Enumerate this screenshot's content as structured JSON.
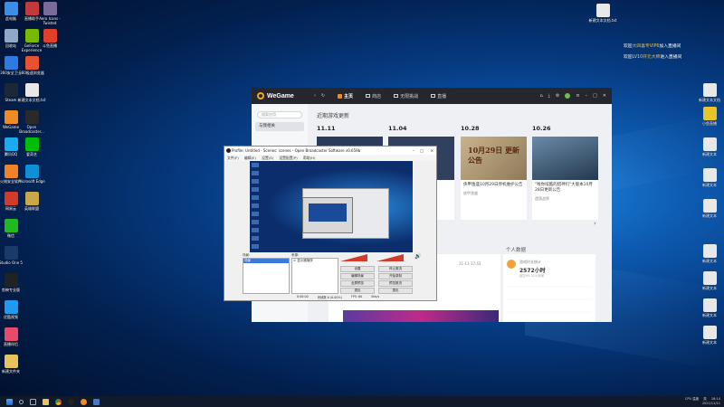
{
  "desktop_icons_left": [
    {
      "label": "此电脑",
      "color": "#3a8ee6"
    },
    {
      "label": "直播助手",
      "color": "#c23a3a"
    },
    {
      "label": "Aero Icons - Twisted",
      "color": "#7b6a9c"
    },
    {
      "label": "回收站",
      "color": "#8fa9c7"
    },
    {
      "label": "GeForce Experience",
      "color": "#76b900"
    },
    {
      "label": "斗鱼直播",
      "color": "#e0402a"
    },
    {
      "label": "360安全卫士",
      "color": "#2d7be0"
    },
    {
      "label": "360极速浏览器",
      "color": "#e8522f"
    },
    {
      "label": "Steam",
      "color": "#1b2838"
    },
    {
      "label": "新建文本文档.txt",
      "color": "#e8e8e8"
    },
    {
      "label": "WeGame",
      "color": "#f08a24"
    },
    {
      "label": "Open Broadcaster...",
      "color": "#2a2a2a"
    },
    {
      "label": "爱奇艺",
      "color": "#00be06"
    },
    {
      "label": "腾讯QQ",
      "color": "#1aabee"
    },
    {
      "label": "火绒安全软件",
      "color": "#f0832a"
    },
    {
      "label": "Microsoft Edge",
      "color": "#0f8fd6"
    },
    {
      "label": "英雄联盟",
      "color": "#c9a84a"
    },
    {
      "label": "网易云",
      "color": "#d23a2a"
    },
    {
      "label": "微信",
      "color": "#1fb922"
    },
    {
      "label": "Studio One 5",
      "color": "#1a3a6a"
    },
    {
      "label": "剪映专业版",
      "color": "#222"
    },
    {
      "label": "优酷视频",
      "color": "#1e9bf0"
    },
    {
      "label": "直播伴侣",
      "color": "#e84a6a"
    },
    {
      "label": "新建文件夹",
      "color": "#e8c35a"
    }
  ],
  "desktop_icons_right": [
    {
      "label": "新建文本文档.txt",
      "color": "#e8e8e8"
    },
    {
      "label": "新建文本文档",
      "color": "#e8e8e8"
    },
    {
      "label": "小鱼直播",
      "color": "#e8c32a"
    },
    {
      "label": "新建文本",
      "color": "#e8e8e8"
    },
    {
      "label": "新建文本",
      "color": "#e8e8e8"
    },
    {
      "label": "新建文本",
      "color": "#e8e8e8"
    },
    {
      "label": "新建文本",
      "color": "#e8e8e8"
    },
    {
      "label": "新建文本",
      "color": "#e8e8e8"
    },
    {
      "label": "新建文本",
      "color": "#e8e8e8"
    },
    {
      "label": "新建文本",
      "color": "#e8e8e8"
    }
  ],
  "danmaku": [
    {
      "text": "欢迎",
      "name": "大四喜专VIP6",
      "tail": "加入直播间"
    },
    {
      "text": "欢迎",
      "name": "LV10开元大师",
      "tail": "进入直播间"
    }
  ],
  "wegame": {
    "logo": "WeGame",
    "nav": [
      {
        "label": "主页",
        "active": true
      },
      {
        "label": "商店",
        "active": false
      },
      {
        "label": "无限挑战",
        "active": false
      },
      {
        "label": "直播",
        "active": false
      }
    ],
    "search_placeholder": "搜索应用",
    "side_item": "与我相关",
    "section_title": "近期游戏更新",
    "dates": [
      "11.11",
      "11.04",
      "10.28",
      "10.26"
    ],
    "cards": [
      {
        "title": "",
        "sub": "",
        "color": "#2a3a5a"
      },
      {
        "title": "",
        "sub": "",
        "color": "#31405e"
      },
      {
        "title": "侠甲渔盛10月29日停机维护公告",
        "sub": "侠甲渔盛",
        "color": "#a08a6a",
        "banner": "10月29日 更新公告"
      },
      {
        "title": "\"啦你炫酷的猎神们\"大版本10月28日更新公告",
        "sub": "遗落战界",
        "color": "#4a6e8a"
      }
    ],
    "personal_title": "个人数据",
    "stat_label": "游戏时长统计",
    "stat_value": "2572小时",
    "stat_sub": "超过95.21%玩家",
    "news_time": "11-11 17:43"
  },
  "obs": {
    "title": "Profile: Untitled - Scenes: scenes - Open Broadcaster Software v0.659b",
    "menu": [
      "文件(F)",
      "编辑(E)",
      "设置(S)",
      "设置配置(P)",
      "帮助(H)"
    ],
    "scenes_label": "场景：",
    "scene_item": "场景",
    "sources_label": "来源：",
    "source_item": "显示器捕获",
    "buttons": [
      "设置",
      "停止推流",
      "编辑场景",
      "开始录制",
      "全屏预览",
      "预览推流",
      "退出",
      "退出"
    ],
    "status": [
      "0:00:00",
      "丢帧数:0 (0.00%)",
      "FPS: 60",
      "0kb/s"
    ]
  },
  "taskbar": {
    "time": "18:14",
    "date": "2021/11/11",
    "tray_text": "英",
    "cpu": "CPU 温度"
  }
}
